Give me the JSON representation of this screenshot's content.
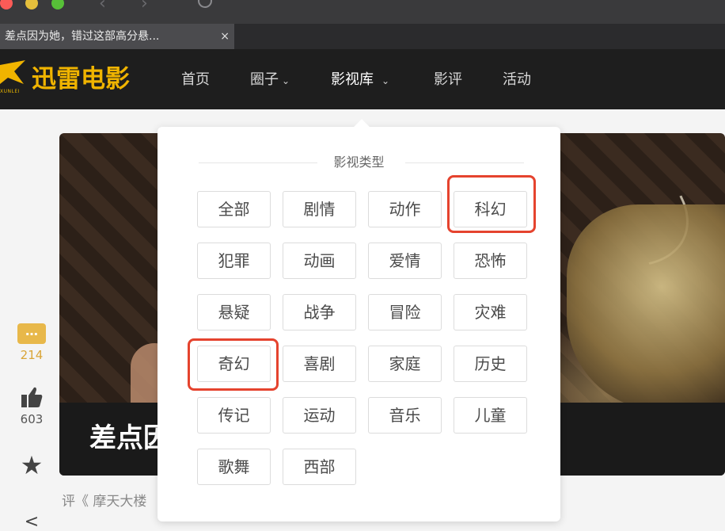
{
  "browser": {
    "tab_title": "差点因为她，错过这部高分悬...",
    "tab_close": "×",
    "back_arrow": "‹",
    "forward_arrow": "›"
  },
  "header": {
    "logo_text": "迅雷电影",
    "logo_sub": "XUNLEI",
    "nav": [
      {
        "label": "首页",
        "chevron": ""
      },
      {
        "label": "圈子",
        "chevron": "⌄"
      },
      {
        "label": "影视库",
        "chevron": "⌄"
      },
      {
        "label": "影评",
        "chevron": ""
      },
      {
        "label": "活动",
        "chevron": ""
      }
    ]
  },
  "article": {
    "title": "差点因为她，错过这部高分悬疑佳作",
    "review_prefix": "评《 摩天大楼"
  },
  "actions": {
    "comment_icon": "…",
    "comments": "214",
    "likes": "603",
    "star": "★",
    "share": "<"
  },
  "dropdown": {
    "section_title": "影视类型",
    "genres": [
      "全部",
      "剧情",
      "动作",
      "科幻",
      "犯罪",
      "动画",
      "爱情",
      "恐怖",
      "悬疑",
      "战争",
      "冒险",
      "灾难",
      "奇幻",
      "喜剧",
      "家庭",
      "历史",
      "传记",
      "运动",
      "音乐",
      "儿童",
      "歌舞",
      "西部"
    ],
    "highlight_color": "#e5432e"
  }
}
